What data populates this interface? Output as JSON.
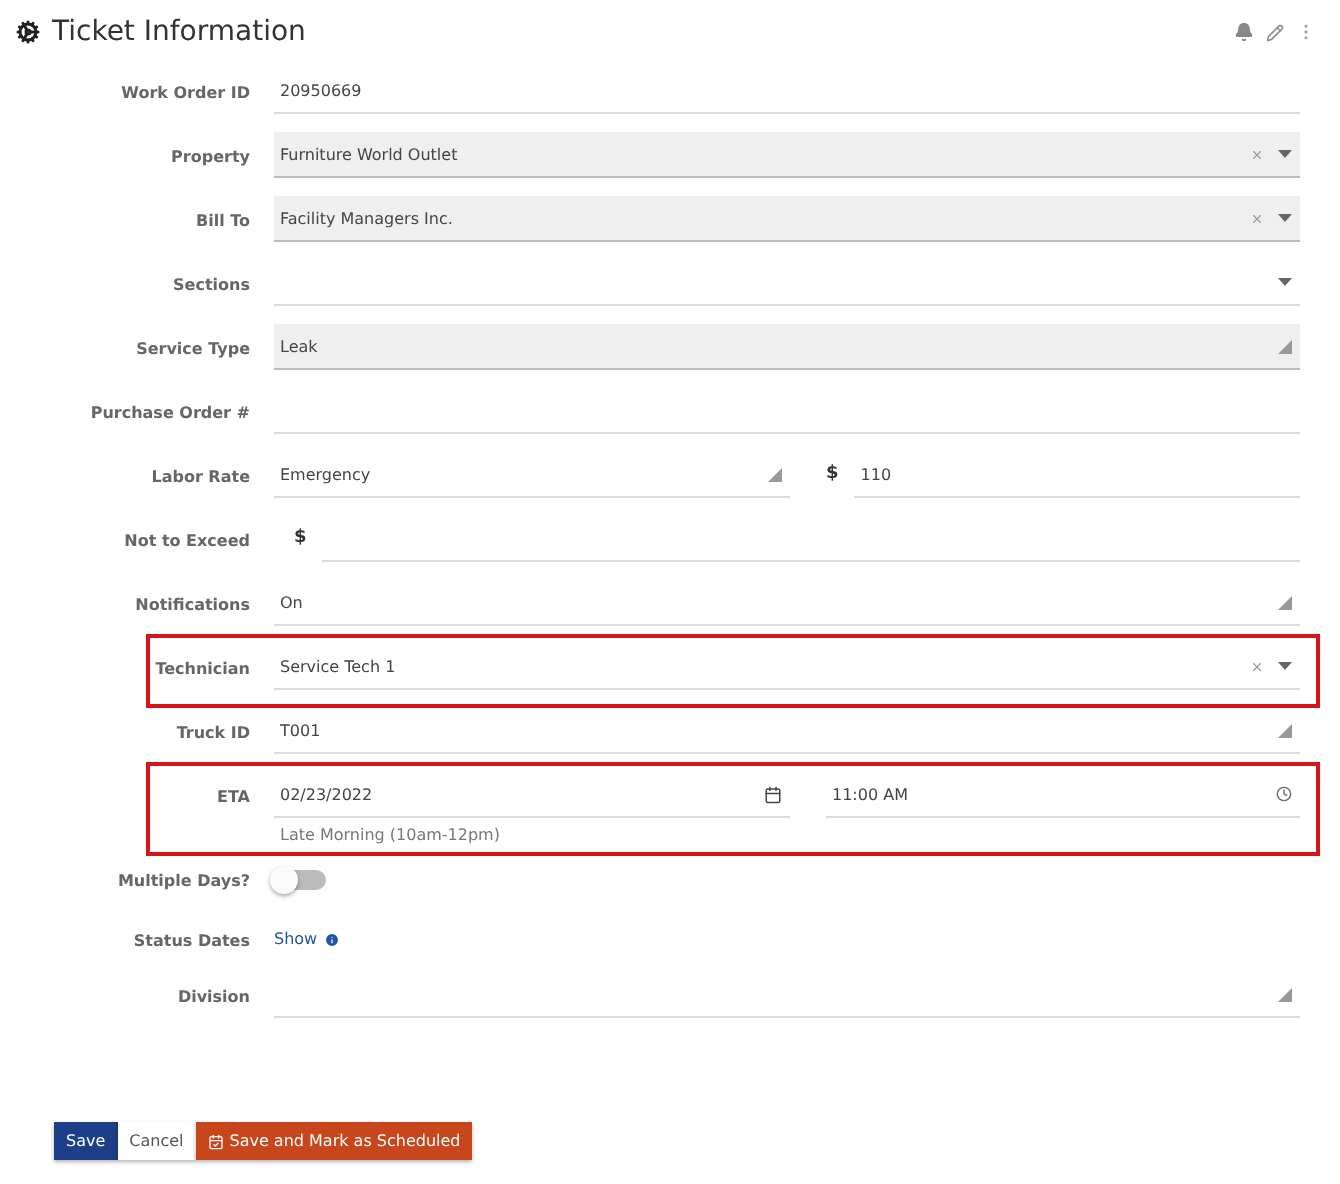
{
  "header": {
    "title": "Ticket Information"
  },
  "rows": [
    {
      "kind": "text",
      "label": "Work Order ID",
      "value": "20950669"
    },
    {
      "kind": "select",
      "label": "Property",
      "value": "Furniture World Outlet",
      "filled": true,
      "clearable": true
    },
    {
      "kind": "select",
      "label": "Bill To",
      "value": "Facility Managers Inc.",
      "filled": true,
      "clearable": true
    },
    {
      "kind": "select",
      "label": "Sections",
      "filled": false,
      "clearable": false
    },
    {
      "kind": "resize",
      "label": "Service Type",
      "value": "Leak",
      "filled": true
    },
    {
      "kind": "text",
      "label": "Purchase Order #"
    },
    {
      "kind": "rate",
      "label": "Labor Rate",
      "value": "Emergency",
      "symbol": "$",
      "amount": "110"
    },
    {
      "kind": "currency",
      "label": "Not to Exceed",
      "symbol": "$"
    },
    {
      "kind": "resize",
      "label": "Notifications",
      "value": "On",
      "filled": false
    },
    {
      "kind": "select",
      "label": "Technician",
      "value": "Service Tech 1",
      "filled": false,
      "clearable": true,
      "highlighted": true
    },
    {
      "kind": "resize",
      "label": "Truck ID",
      "value": "T001",
      "filled": false
    },
    {
      "kind": "datetime",
      "label": "ETA",
      "date": "02/23/2022",
      "time": "11:00 AM",
      "hint": "Late Morning (10am-12pm)",
      "highlighted": true
    },
    {
      "kind": "toggle",
      "label": "Multiple Days?",
      "on": false
    },
    {
      "kind": "link",
      "label": "Status Dates",
      "link": "Show"
    },
    {
      "kind": "resize",
      "label": "Division",
      "filled": false
    }
  ],
  "buttons": [
    {
      "kind": "primary",
      "label": "Save"
    },
    {
      "kind": "plain",
      "label": "Cancel"
    },
    {
      "kind": "danger",
      "label": "Save and Mark as Scheduled"
    }
  ]
}
